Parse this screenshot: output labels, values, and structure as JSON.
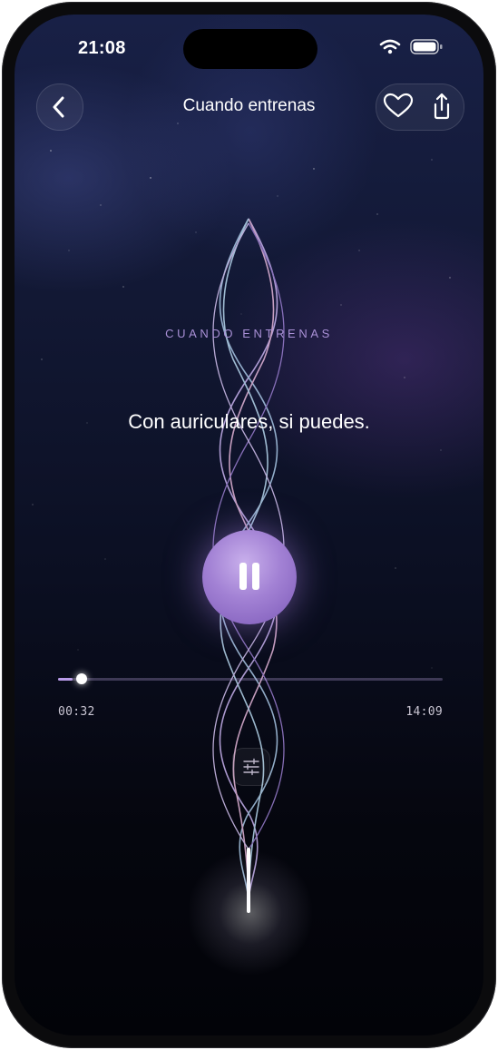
{
  "status_bar": {
    "time": "21:08"
  },
  "header": {
    "title": "Cuando entrenas",
    "back_icon": "chevron-left-icon",
    "favorite_icon": "heart-icon",
    "share_icon": "share-icon"
  },
  "content": {
    "overline": "CUANDO ENTRENAS",
    "quote": "Con auriculares, si puedes."
  },
  "player": {
    "state_icon": "pause-icon",
    "elapsed": "00:32",
    "duration": "14:09",
    "progress": 0.038,
    "mixer_icon": "sliders-icon"
  },
  "colors": {
    "accent": "#a281d4",
    "background": "#0b0f22",
    "overline": "#a990d6"
  }
}
